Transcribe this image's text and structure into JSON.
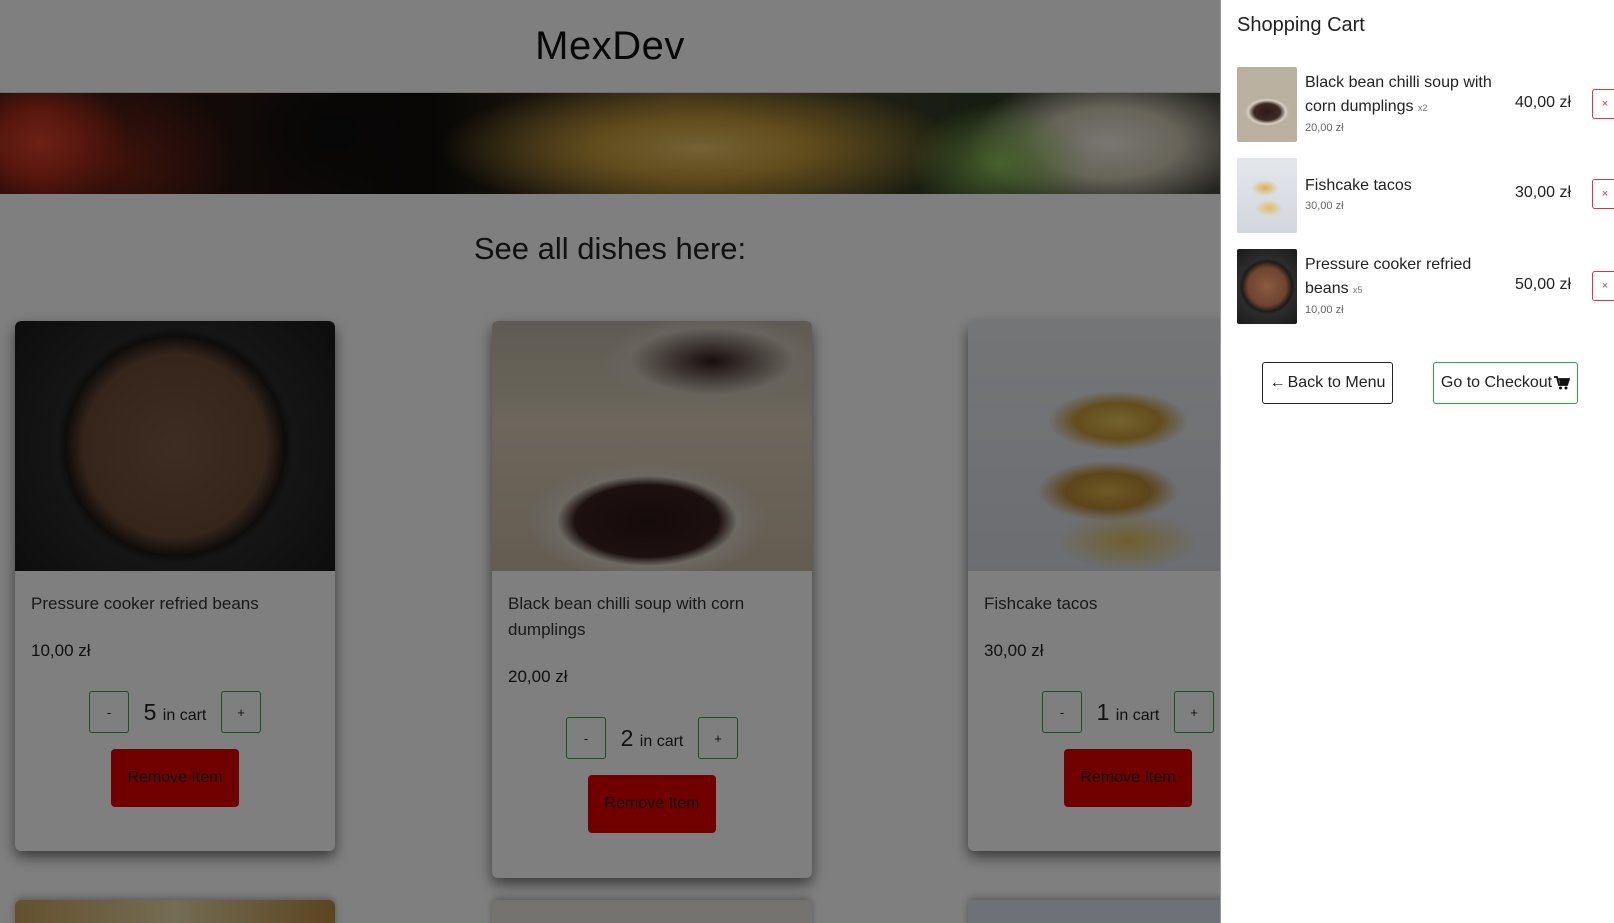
{
  "navbar": {
    "brand": "MexDev"
  },
  "main": {
    "heading": "See all dishes here:",
    "dishes": [
      {
        "title": "Pressure cooker refried beans",
        "price": "10,00 zł",
        "qty": "5",
        "in_cart": "in cart",
        "minus": "-",
        "plus": "+",
        "remove": "Remove Item"
      },
      {
        "title": "Black bean chilli soup with corn dumplings",
        "price": "20,00 zł",
        "qty": "2",
        "in_cart": "in cart",
        "minus": "-",
        "plus": "+",
        "remove": "Remove Item"
      },
      {
        "title": "Fishcake tacos",
        "price": "30,00 zł",
        "qty": "1",
        "in_cart": "in cart",
        "minus": "-",
        "plus": "+",
        "remove": "Remove Item"
      }
    ]
  },
  "cart": {
    "title": "Shopping Cart",
    "items": [
      {
        "name": "Black bean chilli soup with corn dumplings",
        "qty": "x2",
        "unit_price": "20,00 zł",
        "total": "40,00 zł",
        "remove": "×"
      },
      {
        "name": "Fishcake tacos",
        "qty": "",
        "unit_price": "30,00 zł",
        "total": "30,00 zł",
        "remove": "×"
      },
      {
        "name": "Pressure cooker refried beans",
        "qty": "x5",
        "unit_price": "10,00 zł",
        "total": "50,00 zł",
        "remove": "×"
      }
    ],
    "back_label": "Back to Menu",
    "checkout_label": "Go to Checkout",
    "icons": {
      "back": "arrow-left-icon",
      "checkout": "shopping-cart-icon"
    }
  },
  "colors": {
    "accent_green": "#28a745",
    "danger_red": "#dc3545",
    "remove_button": "#e00000"
  }
}
